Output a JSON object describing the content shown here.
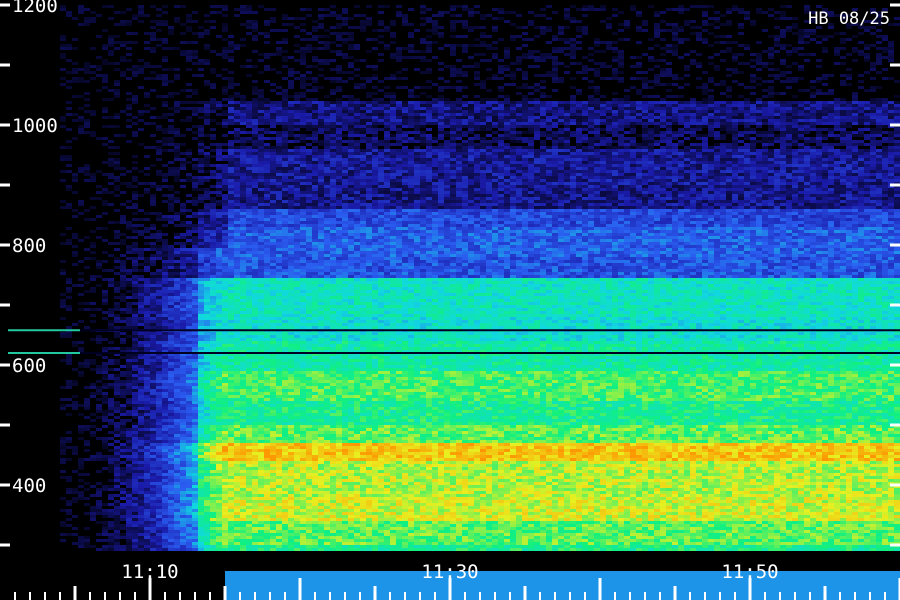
{
  "chart_data": {
    "type": "heatmap",
    "title": "",
    "annotation": "HB 08/25",
    "xlabel": "",
    "ylabel": "",
    "x_ticks": [
      "11:10",
      "11:30",
      "11:50"
    ],
    "y_ticks": [
      400,
      600,
      800,
      1000,
      1200
    ],
    "ylim": [
      280,
      1200
    ],
    "x_range": [
      "11:02",
      "12:00"
    ],
    "colormap": [
      "#000000",
      "#1a1aa8",
      "#2a5cf0",
      "#10d8e0",
      "#10f080",
      "#e8f020",
      "#ff9000",
      "#ff3000"
    ],
    "bands": [
      {
        "from": 290,
        "to": 300,
        "level": 0.55
      },
      {
        "from": 300,
        "to": 340,
        "level": 0.62
      },
      {
        "from": 340,
        "to": 380,
        "level": 0.7
      },
      {
        "from": 380,
        "to": 440,
        "level": 0.68
      },
      {
        "from": 440,
        "to": 470,
        "level": 0.78
      },
      {
        "from": 470,
        "to": 500,
        "level": 0.62
      },
      {
        "from": 500,
        "to": 540,
        "level": 0.55
      },
      {
        "from": 540,
        "to": 590,
        "level": 0.6
      },
      {
        "from": 590,
        "to": 640,
        "level": 0.52
      },
      {
        "from": 640,
        "to": 680,
        "level": 0.46
      },
      {
        "from": 680,
        "to": 745,
        "level": 0.48
      },
      {
        "from": 745,
        "to": 780,
        "level": 0.26
      },
      {
        "from": 780,
        "to": 830,
        "level": 0.28
      },
      {
        "from": 830,
        "to": 860,
        "level": 0.24
      },
      {
        "from": 860,
        "to": 900,
        "level": 0.12
      },
      {
        "from": 900,
        "to": 960,
        "level": 0.13
      },
      {
        "from": 960,
        "to": 1000,
        "level": 0.07
      },
      {
        "from": 1000,
        "to": 1040,
        "level": 0.11
      },
      {
        "from": 1040,
        "to": 1200,
        "level": 0.01
      }
    ],
    "dark_lines_mhz": [
      620,
      658
    ],
    "burst_onset": "11:04",
    "burst_full": "11:14"
  }
}
